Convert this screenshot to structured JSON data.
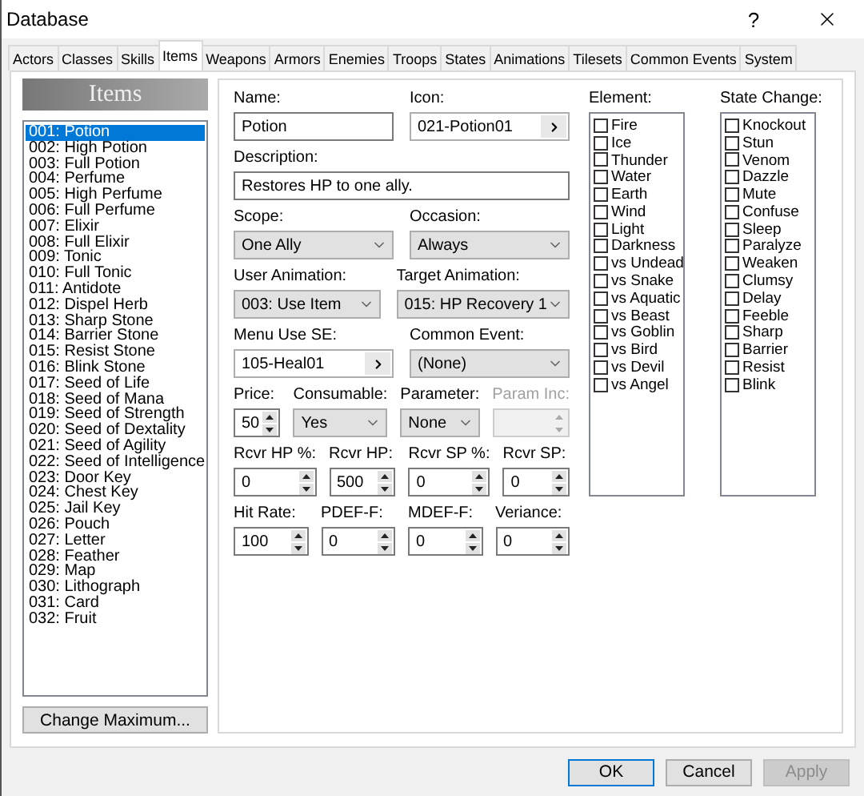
{
  "window": {
    "title": "Database",
    "help": "?"
  },
  "tabs": [
    {
      "label": "Actors",
      "selected": false
    },
    {
      "label": "Classes",
      "selected": false
    },
    {
      "label": "Skills",
      "selected": false
    },
    {
      "label": "Items",
      "selected": true
    },
    {
      "label": "Weapons",
      "selected": false
    },
    {
      "label": "Armors",
      "selected": false
    },
    {
      "label": "Enemies",
      "selected": false
    },
    {
      "label": "Troops",
      "selected": false
    },
    {
      "label": "States",
      "selected": false
    },
    {
      "label": "Animations",
      "selected": false
    },
    {
      "label": "Tilesets",
      "selected": false
    },
    {
      "label": "Common Events",
      "selected": false
    },
    {
      "label": "System",
      "selected": false
    }
  ],
  "list": {
    "header": "Items",
    "button": "Change Maximum...",
    "items": [
      {
        "label": "001: Potion",
        "selected": true
      },
      {
        "label": "002: High Potion",
        "selected": false
      },
      {
        "label": "003: Full Potion",
        "selected": false
      },
      {
        "label": "004: Perfume",
        "selected": false
      },
      {
        "label": "005: High Perfume",
        "selected": false
      },
      {
        "label": "006: Full Perfume",
        "selected": false
      },
      {
        "label": "007: Elixir",
        "selected": false
      },
      {
        "label": "008: Full Elixir",
        "selected": false
      },
      {
        "label": "009: Tonic",
        "selected": false
      },
      {
        "label": "010: Full Tonic",
        "selected": false
      },
      {
        "label": "011: Antidote",
        "selected": false
      },
      {
        "label": "012: Dispel Herb",
        "selected": false
      },
      {
        "label": "013: Sharp Stone",
        "selected": false
      },
      {
        "label": "014: Barrier Stone",
        "selected": false
      },
      {
        "label": "015: Resist Stone",
        "selected": false
      },
      {
        "label": "016: Blink Stone",
        "selected": false
      },
      {
        "label": "017: Seed of Life",
        "selected": false
      },
      {
        "label": "018: Seed of Mana",
        "selected": false
      },
      {
        "label": "019: Seed of Strength",
        "selected": false
      },
      {
        "label": "020: Seed of Dextality",
        "selected": false
      },
      {
        "label": "021: Seed of Agility",
        "selected": false
      },
      {
        "label": "022: Seed of Intelligence",
        "selected": false
      },
      {
        "label": "023: Door Key",
        "selected": false
      },
      {
        "label": "024: Chest Key",
        "selected": false
      },
      {
        "label": "025: Jail Key",
        "selected": false
      },
      {
        "label": "026: Pouch",
        "selected": false
      },
      {
        "label": "027: Letter",
        "selected": false
      },
      {
        "label": "028: Feather",
        "selected": false
      },
      {
        "label": "029: Map",
        "selected": false
      },
      {
        "label": "030: Lithograph",
        "selected": false
      },
      {
        "label": "031: Card",
        "selected": false
      },
      {
        "label": "032: Fruit",
        "selected": false
      }
    ]
  },
  "form": [
    [
      {
        "label": "Name:",
        "kind": "text",
        "value": "Potion"
      },
      {
        "label": "Icon:",
        "kind": "picker",
        "value": "021-Potion01"
      }
    ],
    [
      {
        "label": "Description:",
        "kind": "text",
        "value": "Restores HP to one ally."
      }
    ],
    [
      {
        "label": "Scope:",
        "kind": "select",
        "value": "One Ally"
      },
      {
        "label": "Occasion:",
        "kind": "select",
        "value": "Always"
      }
    ],
    [
      {
        "label": "User Animation:",
        "kind": "select",
        "value": "003: Use Item"
      },
      {
        "label": "Target Animation:",
        "kind": "select",
        "value": "015: HP Recovery 1"
      }
    ],
    [
      {
        "label": "Menu Use SE:",
        "kind": "picker",
        "value": "105-Heal01"
      },
      {
        "label": "Common Event:",
        "kind": "select",
        "value": "(None)"
      }
    ],
    [
      {
        "label": "Price:",
        "kind": "spin",
        "value": "50",
        "disabled": false
      },
      {
        "label": "Consumable:",
        "kind": "select",
        "value": "Yes"
      },
      {
        "label": "Parameter:",
        "kind": "select",
        "value": "None"
      },
      {
        "label": "Param Inc:",
        "kind": "spin",
        "disabled": true
      }
    ],
    [
      {
        "label": "Rcvr HP %:",
        "kind": "spin",
        "value": "0",
        "disabled": false
      },
      {
        "label": "Rcvr HP:",
        "kind": "spin",
        "value": "500",
        "disabled": false
      },
      {
        "label": "Rcvr SP %:",
        "kind": "spin",
        "value": "0",
        "disabled": false
      },
      {
        "label": "Rcvr SP:",
        "kind": "spin",
        "value": "0",
        "disabled": false
      }
    ],
    [
      {
        "label": "Hit Rate:",
        "kind": "spin",
        "value": "100",
        "disabled": false
      },
      {
        "label": "PDEF-F:",
        "kind": "spin",
        "value": "0",
        "disabled": false
      },
      {
        "label": "MDEF-F:",
        "kind": "spin",
        "value": "0",
        "disabled": false
      },
      {
        "label": "Veriance:",
        "kind": "spin",
        "value": "0",
        "disabled": false
      }
    ]
  ],
  "checklists": [
    {
      "title": "Element:",
      "items": [
        {
          "label": "Fire",
          "checked": false
        },
        {
          "label": "Ice",
          "checked": false
        },
        {
          "label": "Thunder",
          "checked": false
        },
        {
          "label": "Water",
          "checked": false
        },
        {
          "label": "Earth",
          "checked": false
        },
        {
          "label": "Wind",
          "checked": false
        },
        {
          "label": "Light",
          "checked": false
        },
        {
          "label": "Darkness",
          "checked": false
        },
        {
          "label": "vs Undead",
          "checked": false
        },
        {
          "label": "vs Snake",
          "checked": false
        },
        {
          "label": "vs Aquatic",
          "checked": false
        },
        {
          "label": "vs Beast",
          "checked": false
        },
        {
          "label": "vs Goblin",
          "checked": false
        },
        {
          "label": "vs Bird",
          "checked": false
        },
        {
          "label": "vs Devil",
          "checked": false
        },
        {
          "label": "vs Angel",
          "checked": false
        }
      ]
    },
    {
      "title": "State Change:",
      "items": [
        {
          "label": "Knockout",
          "checked": false
        },
        {
          "label": "Stun",
          "checked": false
        },
        {
          "label": "Venom",
          "checked": false
        },
        {
          "label": "Dazzle",
          "checked": false
        },
        {
          "label": "Mute",
          "checked": false
        },
        {
          "label": "Confuse",
          "checked": false
        },
        {
          "label": "Sleep",
          "checked": false
        },
        {
          "label": "Paralyze",
          "checked": false
        },
        {
          "label": "Weaken",
          "checked": false
        },
        {
          "label": "Clumsy",
          "checked": false
        },
        {
          "label": "Delay",
          "checked": false
        },
        {
          "label": "Feeble",
          "checked": false
        },
        {
          "label": "Sharp",
          "checked": false
        },
        {
          "label": "Barrier",
          "checked": false
        },
        {
          "label": "Resist",
          "checked": false
        },
        {
          "label": "Blink",
          "checked": false
        }
      ]
    }
  ],
  "buttons": [
    {
      "label": "OK",
      "kind": "default",
      "disabled": false
    },
    {
      "label": "Cancel",
      "kind": "normal",
      "disabled": false
    },
    {
      "label": "Apply",
      "kind": "normal",
      "disabled": true
    }
  ]
}
